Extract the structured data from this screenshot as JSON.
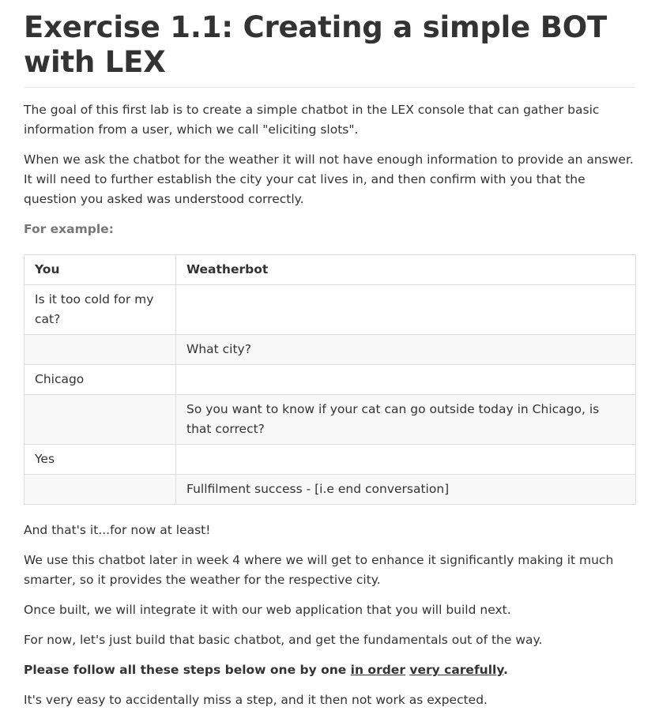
{
  "title": "Exercise 1.1: Creating a simple BOT with LEX",
  "intro": [
    "The goal of this first lab is to create a simple chatbot in the LEX console that can gather basic information from a user, which we call \"eliciting slots\".",
    "When we ask the chatbot for the weather it will not have enough information to provide an answer.  It will need to further establish the city your cat lives in, and then confirm with you that the question you asked was understood correctly."
  ],
  "example_label": "For example:",
  "table": {
    "headers": [
      "You",
      "Weatherbot"
    ],
    "rows": [
      [
        "Is it too cold for my cat?",
        ""
      ],
      [
        "",
        "What city?"
      ],
      [
        "Chicago",
        ""
      ],
      [
        "",
        "So you want to know if your cat can go outside today in Chicago, is that correct?"
      ],
      [
        "Yes",
        ""
      ],
      [
        "",
        "Fullfilment success - [i.e  end conversation]"
      ]
    ]
  },
  "outro": [
    "And that's it...for now at least!",
    "We use this chatbot later in week 4 where we will get to enhance it significantly making it much smarter, so it provides the weather for the respective city.",
    "Once built, we will integrate it with our web application that you will build next.",
    "For now, let's just build that basic chatbot, and get the fundamentals out of the way."
  ],
  "instruction": {
    "prefix": "Please follow all these steps below one by one ",
    "link1": "in order",
    "space": " ",
    "link2": "very carefully",
    "suffix": "."
  },
  "warning": "It's very easy to accidentally miss a step, and it then not work as expected."
}
